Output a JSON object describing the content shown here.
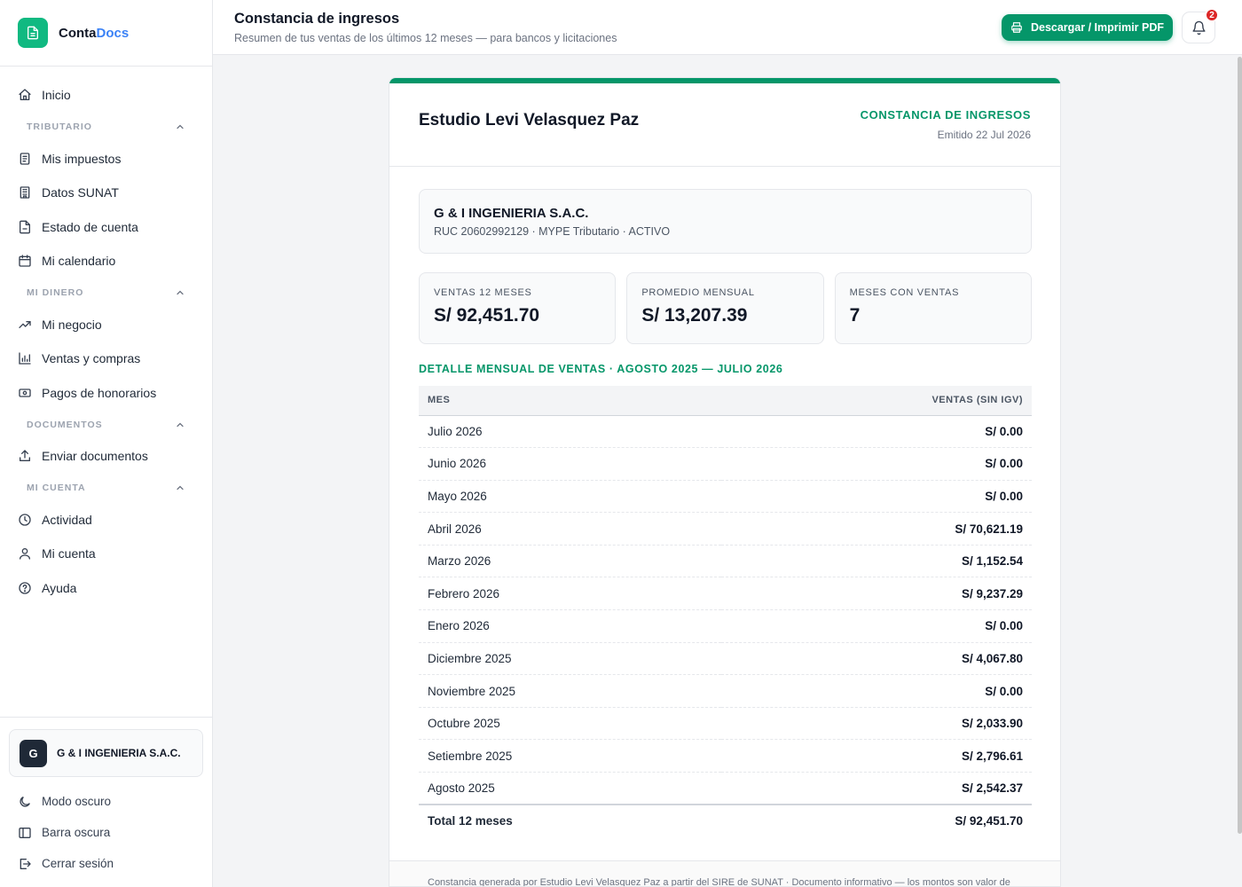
{
  "brand": {
    "name_main": "Conta",
    "name_accent": "Docs"
  },
  "sidebar": {
    "inicio": "Inicio",
    "groups": [
      {
        "label": "TRIBUTARIO",
        "items": [
          "Mis impuestos",
          "Datos SUNAT",
          "Estado de cuenta",
          "Mi calendario"
        ]
      },
      {
        "label": "MI DINERO",
        "items": [
          "Mi negocio",
          "Ventas y compras",
          "Pagos de honorarios"
        ]
      },
      {
        "label": "DOCUMENTOS",
        "items": [
          "Enviar documentos"
        ]
      },
      {
        "label": "MI CUENTA",
        "items": [
          "Actividad",
          "Mi cuenta",
          "Ayuda"
        ]
      }
    ],
    "account": {
      "initial": "G",
      "name": "G & I INGENIERIA S.A.C."
    },
    "bottom": {
      "dark_mode": "Modo oscuro",
      "dark_bar": "Barra oscura",
      "logout": "Cerrar sesión"
    }
  },
  "header": {
    "title": "Constancia de ingresos",
    "subtitle": "Resumen de tus ventas de los últimos 12 meses — para bancos y licitaciones",
    "pdf_button": "Descargar / Imprimir PDF",
    "notifications": "2"
  },
  "document": {
    "studio": "Estudio Levi Velasquez Paz",
    "kind": "CONSTANCIA DE INGRESOS",
    "issued": "Emitido 22 Jul 2026",
    "company": {
      "name": "G & I INGENIERIA S.A.C.",
      "meta": "RUC 20602992129 · MYPE Tributario · ACTIVO"
    },
    "kpis": [
      {
        "label": "VENTAS 12 MESES",
        "value": "S/ 92,451.70"
      },
      {
        "label": "PROMEDIO MENSUAL",
        "value": "S/ 13,207.39"
      },
      {
        "label": "MESES CON VENTAS",
        "value": "7"
      }
    ],
    "section_title": "DETALLE MENSUAL DE VENTAS · AGOSTO 2025 — JULIO 2026",
    "table": {
      "col_month": "MES",
      "col_sales": "VENTAS (SIN IGV)",
      "rows": [
        {
          "month": "Julio 2026",
          "amount": "S/ 0.00"
        },
        {
          "month": "Junio 2026",
          "amount": "S/ 0.00"
        },
        {
          "month": "Mayo 2026",
          "amount": "S/ 0.00"
        },
        {
          "month": "Abril 2026",
          "amount": "S/ 70,621.19"
        },
        {
          "month": "Marzo 2026",
          "amount": "S/ 1,152.54"
        },
        {
          "month": "Febrero 2026",
          "amount": "S/ 9,237.29"
        },
        {
          "month": "Enero 2026",
          "amount": "S/ 0.00"
        },
        {
          "month": "Diciembre 2025",
          "amount": "S/ 4,067.80"
        },
        {
          "month": "Noviembre 2025",
          "amount": "S/ 0.00"
        },
        {
          "month": "Octubre 2025",
          "amount": "S/ 2,033.90"
        },
        {
          "month": "Setiembre 2025",
          "amount": "S/ 2,796.61"
        },
        {
          "month": "Agosto 2025",
          "amount": "S/ 2,542.37"
        }
      ],
      "total_label": "Total 12 meses",
      "total_value": "S/ 92,451.70"
    },
    "footer": "Constancia generada por Estudio Levi Velasquez Paz a partir del SIRE de SUNAT · Documento informativo — los montos son valor de"
  },
  "colors": {
    "accent": "#059669",
    "brand": "#10b981",
    "link_accent": "#3b82f6",
    "badge": "#dc2626"
  }
}
